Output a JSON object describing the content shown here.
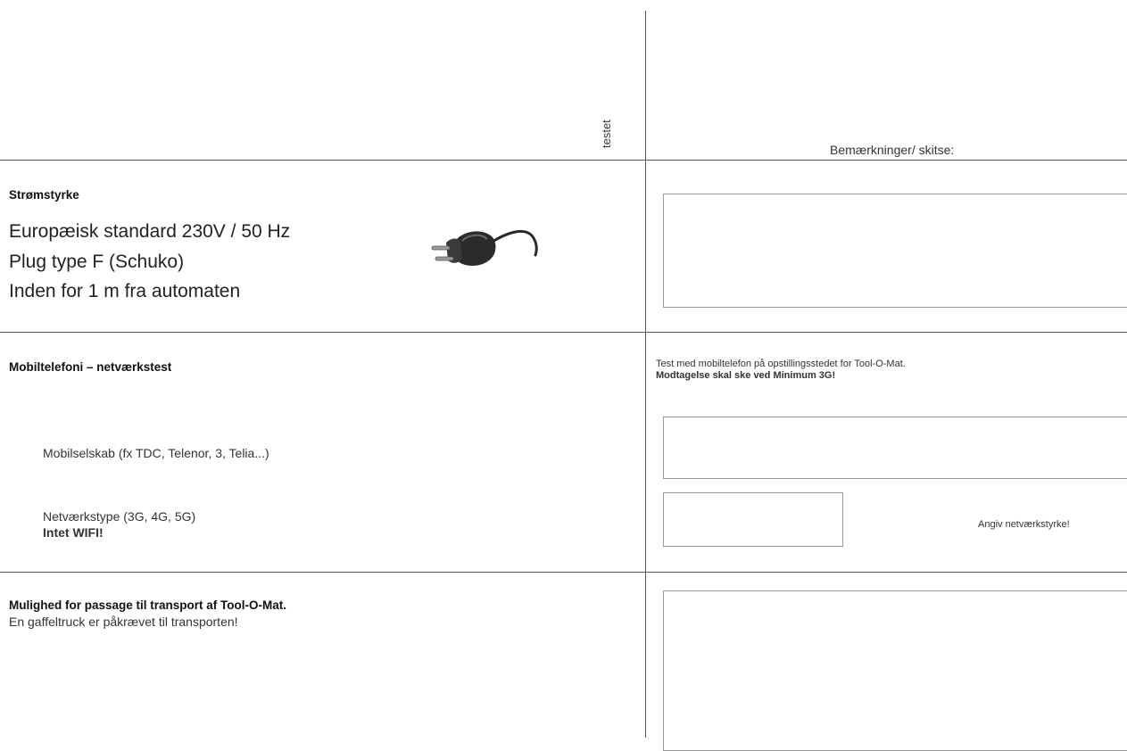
{
  "header": {
    "testet_label": "testet",
    "remarks_label": "Bemærkninger/ skitse:"
  },
  "power": {
    "title": "Strømstyrke",
    "line1": "Europæisk standard 230V / 50 Hz",
    "line2": "Plug type F (Schuko)",
    "line3": "Inden for 1 m fra automaten",
    "icon": "power-plug-icon"
  },
  "mobile": {
    "title": "Mobiltelefoni – netværkstest",
    "operator_label": "Mobilselskab (fx TDC, Telenor, 3, Telia...)",
    "network_type_label": "Netværkstype (3G, 4G, 5G)",
    "no_wifi": "Intet WIFI!",
    "instruction": "Test med mobiltelefon på opstillingsstedet for Tool-O-Mat.",
    "requirement": "Modtagelse skal ske ved Minimum 3G!",
    "strength_label": "Angiv netværkstyrke!"
  },
  "transport": {
    "title": "Mulighed for passage til transport af Tool-O-Mat.",
    "note": "En gaffeltruck er påkrævet til transporten!"
  }
}
